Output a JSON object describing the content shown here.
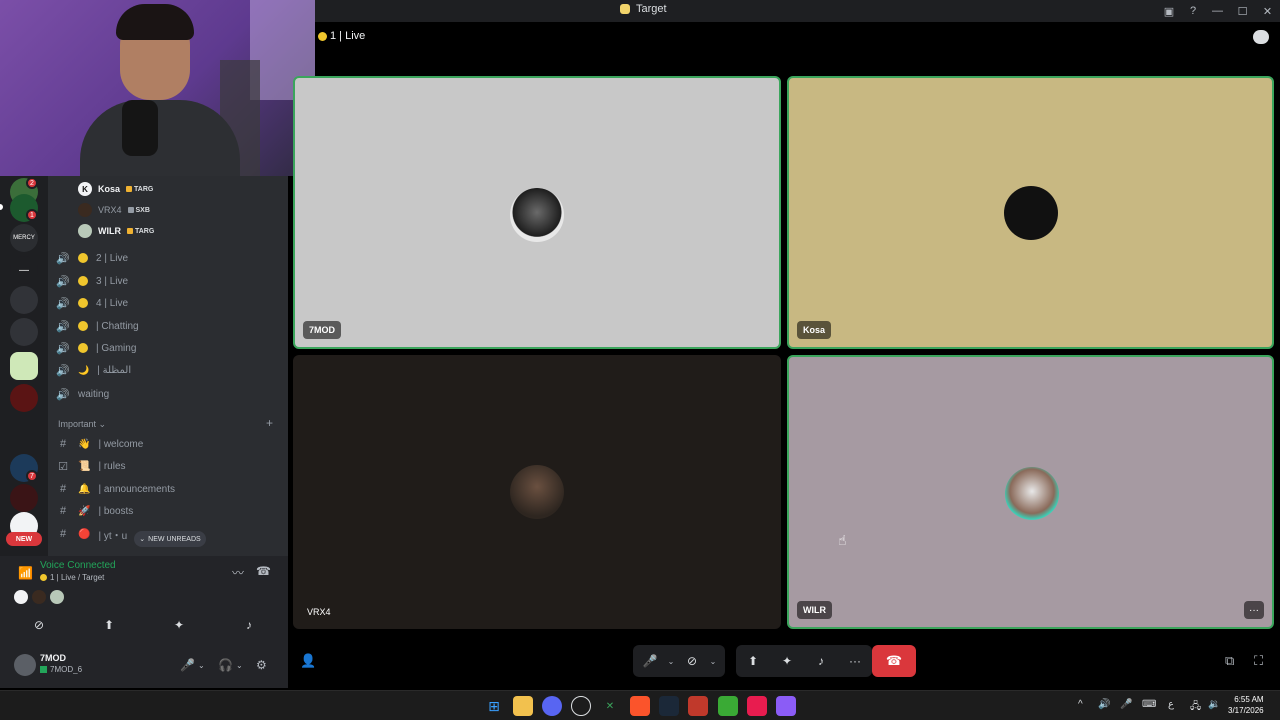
{
  "window": {
    "title": "Target"
  },
  "stage": {
    "header_dot": "🟡",
    "header": "1 | Live"
  },
  "voice_users": [
    {
      "name": "Kosa",
      "tag": "TARG"
    },
    {
      "name": "VRX4",
      "tag": "SXB"
    },
    {
      "name": "WILR",
      "tag": "TARG"
    }
  ],
  "channels": [
    {
      "label": "2 | Live"
    },
    {
      "label": "3 | Live"
    },
    {
      "label": "4 | Live"
    },
    {
      "label": "| Chatting"
    },
    {
      "label": "| Gaming"
    },
    {
      "label": "| المظلة"
    },
    {
      "label": "waiting"
    }
  ],
  "category": {
    "name": "Important",
    "chevron": "⌄",
    "add": "+"
  },
  "text_channels": [
    {
      "label": "| welcome",
      "emoji": "👋"
    },
    {
      "label": "| rules",
      "emoji": "📜"
    },
    {
      "label": "| announcements",
      "emoji": "🔔"
    },
    {
      "label": "| boosts",
      "emoji": "🚀"
    },
    {
      "label": "| yt・u",
      "emoji": "🔴"
    }
  ],
  "new_unreads": "NEW UNREADS",
  "server_badges": {
    "b1": "2",
    "b2": "1",
    "b3": "7",
    "new": "NEW"
  },
  "voice_panel": {
    "status": "Voice Connected",
    "location": "1 | Live / Target"
  },
  "user": {
    "name": "7MOD",
    "status": "7MOD_6"
  },
  "tiles": [
    {
      "name": "7MOD",
      "bg": "#c8c8c8",
      "speaking": true
    },
    {
      "name": "Kosa",
      "bg": "#c8b882",
      "speaking": true
    },
    {
      "name": "VRX4",
      "bg": "#201c19",
      "speaking": false
    },
    {
      "name": "WILR",
      "bg": "#a69aa2",
      "speaking": true
    }
  ],
  "tile_more": "···",
  "taskbar": {
    "time": "6:55 AM",
    "date": "3/17/2026",
    "lang": "ع"
  },
  "colors": {
    "accent_green": "#23a55a",
    "danger": "#da373c",
    "live_dot": "#f0c62d"
  }
}
